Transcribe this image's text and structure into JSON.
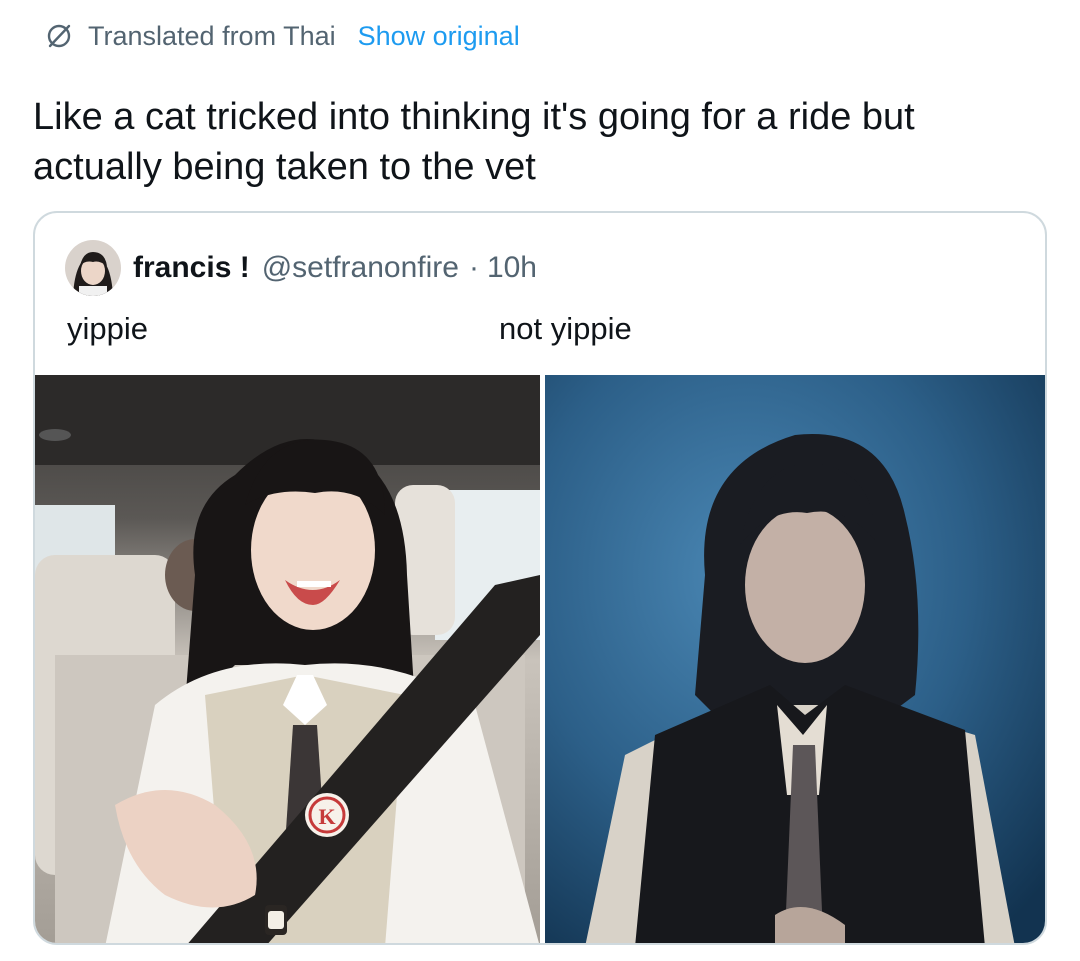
{
  "translation": {
    "label": "Translated from Thai",
    "show_original": "Show original"
  },
  "tweet": {
    "text": "Like a cat tricked into thinking it's going for a ride but actually being taken to the vet"
  },
  "quoted_tweet": {
    "name": "francis !",
    "handle": "@setfranonfire",
    "separator": "·",
    "time": "10h",
    "caption_left": "yippie",
    "caption_right": "not yippie",
    "badge_letter": "K"
  },
  "colors": {
    "link": "#1d9bf0",
    "secondary_text": "#536471",
    "border": "#cfd9de"
  },
  "icons": {
    "translate": "globe-strike-icon"
  }
}
